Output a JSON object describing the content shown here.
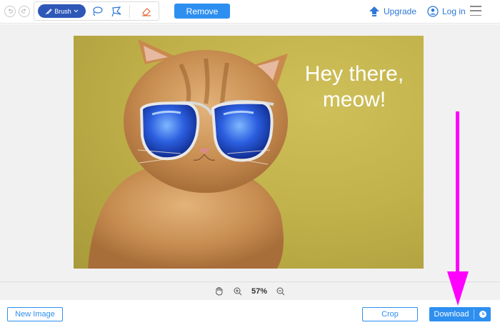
{
  "toolbar": {
    "brush_label": "Brush",
    "remove_label": "Remove",
    "upgrade_label": "Upgrade",
    "login_label": "Log in"
  },
  "icons": {
    "undo": "undo-icon",
    "redo": "redo-icon",
    "brush": "brush-icon",
    "lasso": "lasso-icon",
    "polygonal_lasso": "polygon-lasso-icon",
    "eraser": "eraser-icon",
    "upgrade": "upgrade-arrow-icon",
    "user": "user-icon",
    "menu": "hamburger-menu-icon",
    "hand": "hand-icon",
    "zoom_in": "zoom-in-icon",
    "zoom_out": "zoom-out-icon",
    "clock": "clock-icon"
  },
  "image": {
    "overlay_line1": "Hey there,",
    "overlay_line2": "meow!"
  },
  "zoom": {
    "level": "57%"
  },
  "bottom": {
    "new_image_label": "New Image",
    "crop_label": "Crop",
    "download_label": "Download"
  },
  "colors": {
    "primary": "#2d8ff0",
    "brush_button": "#2e57b8",
    "annotation_arrow": "#ff00ff",
    "image_background": "#c2b24b"
  }
}
